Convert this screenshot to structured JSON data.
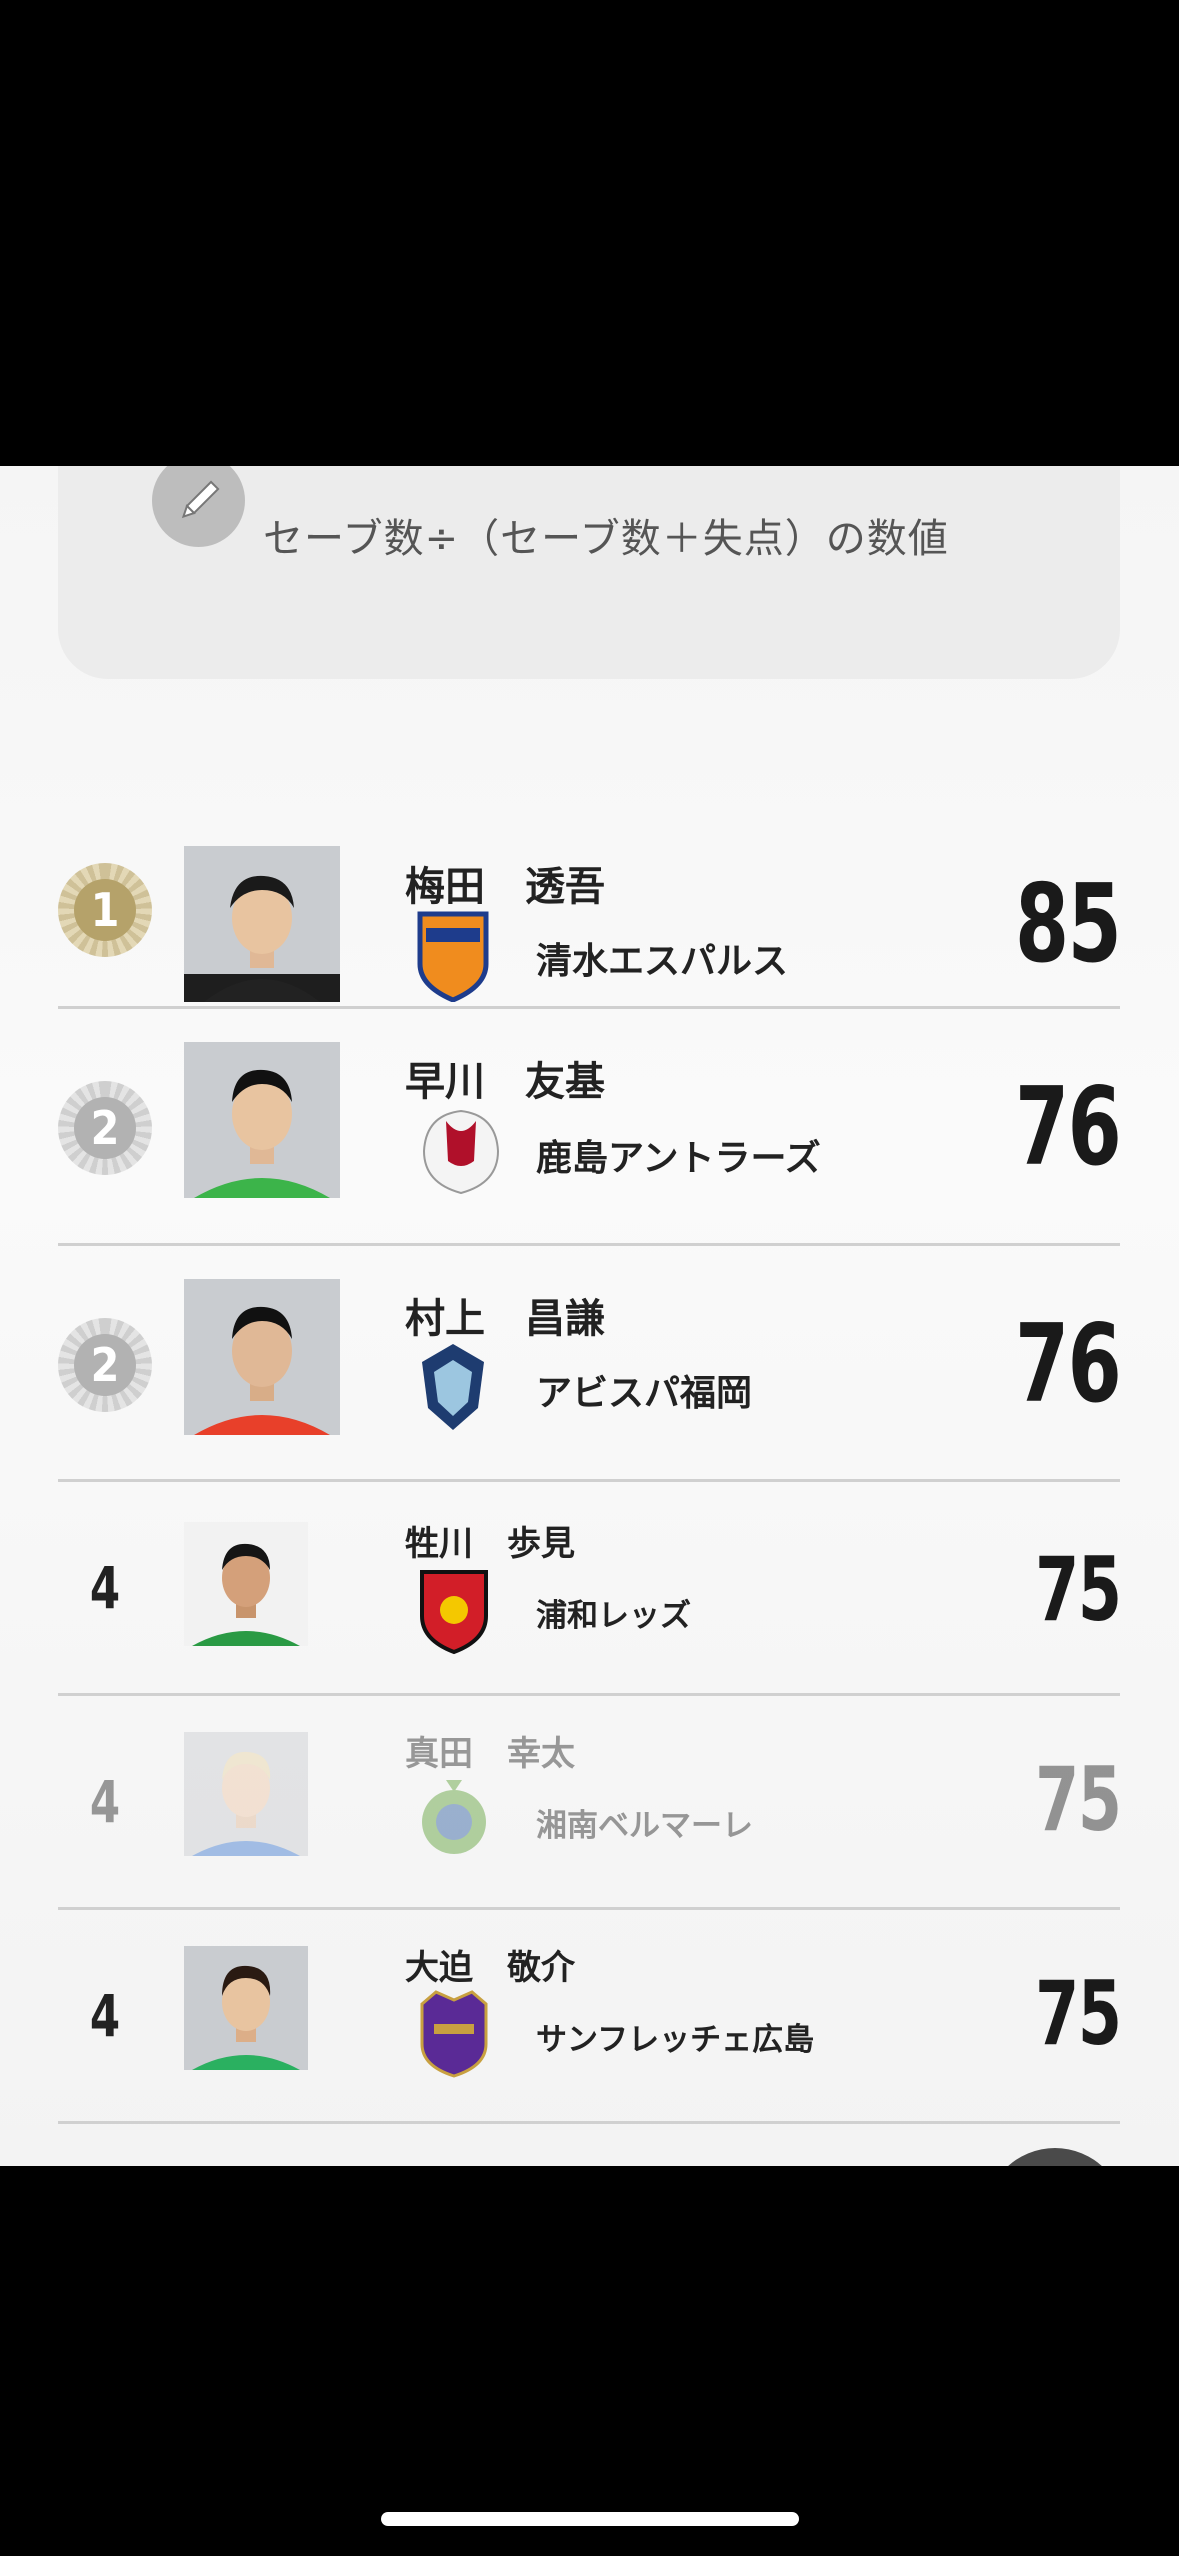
{
  "formula": {
    "text": "セーブ数÷（セーブ数＋失点）の数値",
    "icon": "pencil-icon"
  },
  "ranking": [
    {
      "rank": "1",
      "medal": "gold",
      "player": "梅田　透吾",
      "club": "清水エスパルス",
      "value": "85",
      "club_colors": [
        "#f08c1e",
        "#1e3c8c"
      ]
    },
    {
      "rank": "2",
      "medal": "silver",
      "player": "早川　友基",
      "club": "鹿島アントラーズ",
      "value": "76",
      "club_colors": [
        "#b0102a",
        "#ffffff"
      ]
    },
    {
      "rank": "2",
      "medal": "silver",
      "player": "村上　昌謙",
      "club": "アビスパ福岡",
      "value": "76",
      "club_colors": [
        "#1e3c70",
        "#9cc6e0"
      ]
    },
    {
      "rank": "4",
      "medal": "none",
      "player": "牲川　歩見",
      "club": "浦和レッズ",
      "value": "75",
      "club_colors": [
        "#d21e28",
        "#111111"
      ]
    },
    {
      "rank": "4",
      "medal": "none",
      "player": "真田　幸太",
      "club": "湘南ベルマーレ",
      "value": "75",
      "club_colors": [
        "#5aa032",
        "#2a5aa0"
      ]
    },
    {
      "rank": "4",
      "medal": "none",
      "player": "大迫　敬介",
      "club": "サンフレッチェ広島",
      "value": "75",
      "club_colors": [
        "#5a2a96",
        "#c8a040"
      ]
    }
  ]
}
